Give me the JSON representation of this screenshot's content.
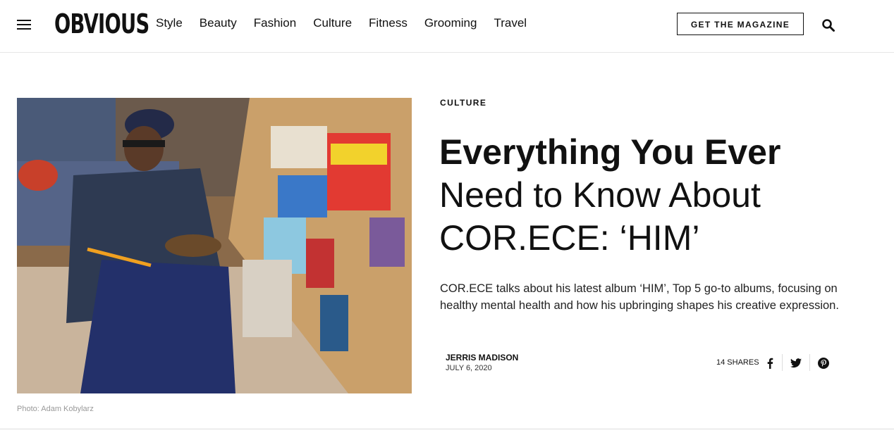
{
  "brand": {
    "logo": "OBVIOUS"
  },
  "nav": [
    "Style",
    "Beauty",
    "Fashion",
    "Culture",
    "Fitness",
    "Grooming",
    "Travel"
  ],
  "header": {
    "magazine_button": "GET THE MAGAZINE"
  },
  "icons": {
    "menu": "hamburger-icon",
    "search": "search-icon",
    "facebook": "facebook-icon",
    "twitter": "twitter-icon",
    "pinterest": "pinterest-icon"
  },
  "article": {
    "category": "CULTURE",
    "title_bold": "Everything You Ever",
    "title_rest": "Need to Know About COR.ECE: ‘HIM’",
    "subtitle": "COR.ECE talks about his latest album ‘HIM’, Top 5 go-to albums, focusing on healthy mental health and how his upbringing shapes his creative expression.",
    "author": "JERRIS MADISON",
    "date": "JULY 6, 2020",
    "shares": "14 SHARES",
    "photo_caption": "Photo: Adam Kobylarz"
  }
}
